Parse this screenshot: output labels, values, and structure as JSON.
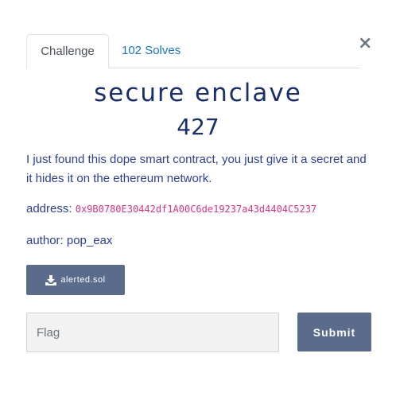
{
  "tabs": {
    "challenge_label": "Challenge",
    "solves_label": "102 Solves"
  },
  "close_label": "×",
  "challenge": {
    "name": "secure enclave",
    "points": "427",
    "description": "I just found this dope smart contract, you just give it a secret and it hides it on the ethereum network.",
    "address_label": "address:",
    "address_value": "0x9B0780E30442df1A00C6de19237a43d4404C5237",
    "author": "author: pop_eax"
  },
  "file": {
    "name": "alerted.sol",
    "icon": "download-icon"
  },
  "form": {
    "flag_placeholder": "Flag",
    "submit_label": "Submit"
  },
  "colors": {
    "accent": "#5a6b8c",
    "title": "#1a2e6b",
    "text": "#2c3e95",
    "link": "#1e71c9",
    "code": "#d63384"
  }
}
